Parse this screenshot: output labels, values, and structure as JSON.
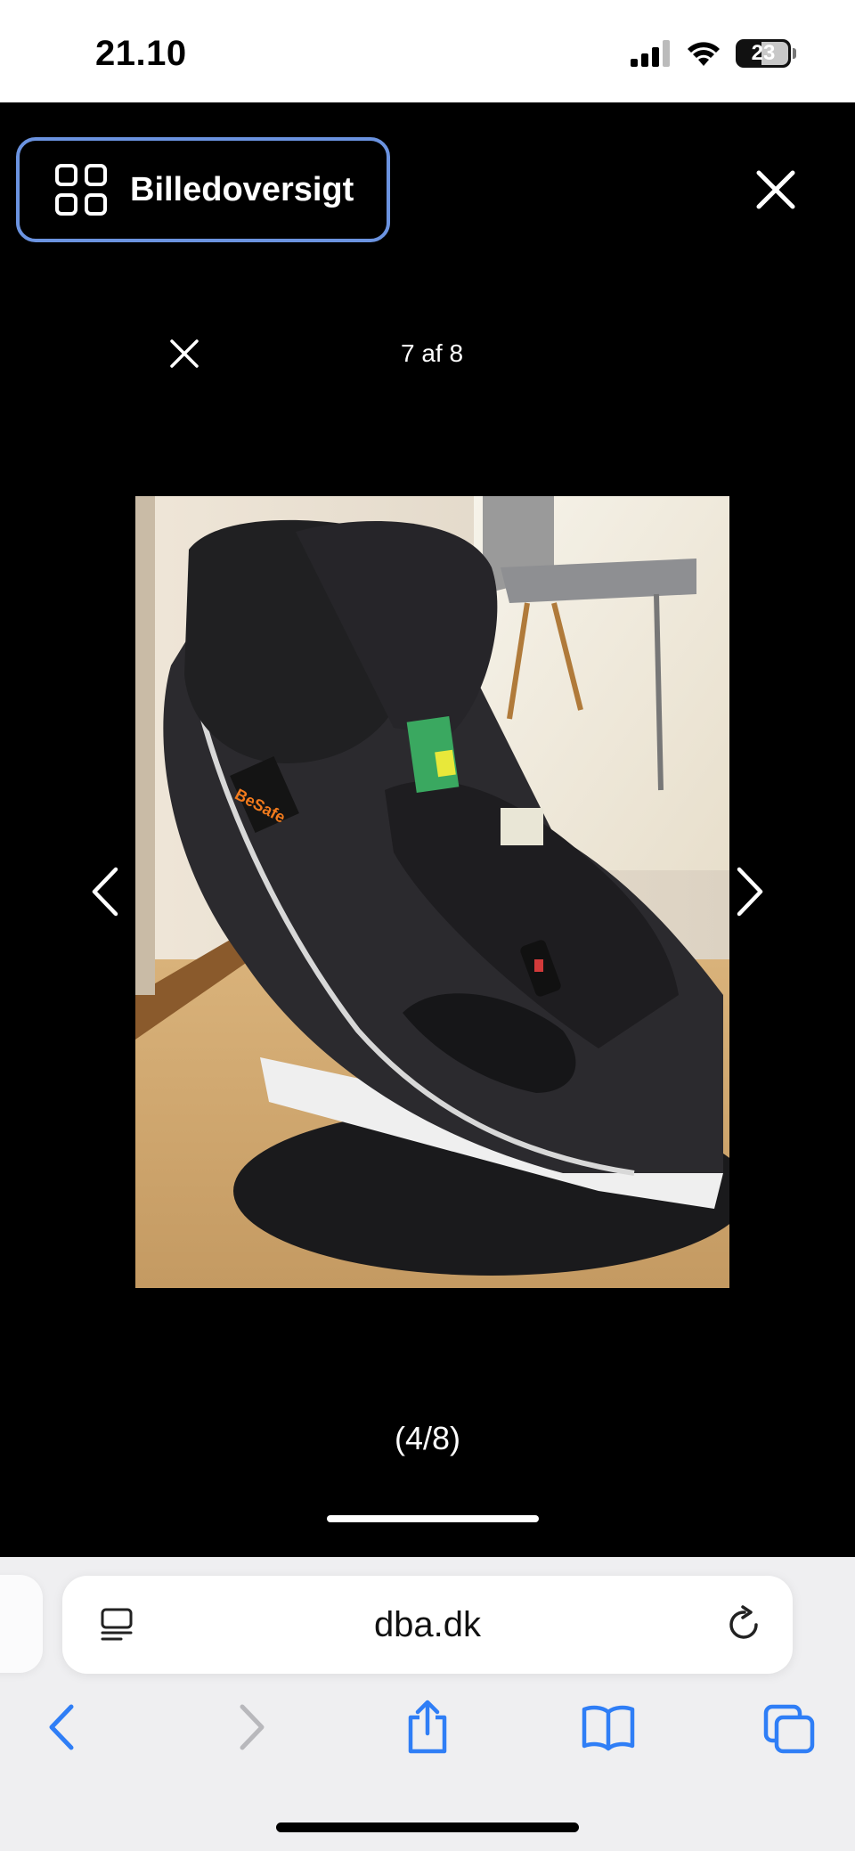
{
  "status_bar": {
    "time": "21.10",
    "battery_level": "23",
    "icons": [
      "signal-icon",
      "wifi-icon",
      "battery-icon"
    ]
  },
  "overlay": {
    "overview_button_label": "Billedoversigt",
    "overview_icon": "grid-icon",
    "close_icon": "close-icon",
    "accent_color": "#6b93e0"
  },
  "viewer": {
    "counter": "7 af 8",
    "caption": "(4/8)",
    "prev_icon": "chevron-left-icon",
    "next_icon": "chevron-right-icon",
    "photo_alt": "BeSafe car seat"
  },
  "safari": {
    "url": "dba.dk",
    "tint_color": "#2f7ef6",
    "toolbar": [
      "back-icon",
      "forward-icon",
      "share-icon",
      "bookmarks-icon",
      "tabs-icon"
    ]
  }
}
